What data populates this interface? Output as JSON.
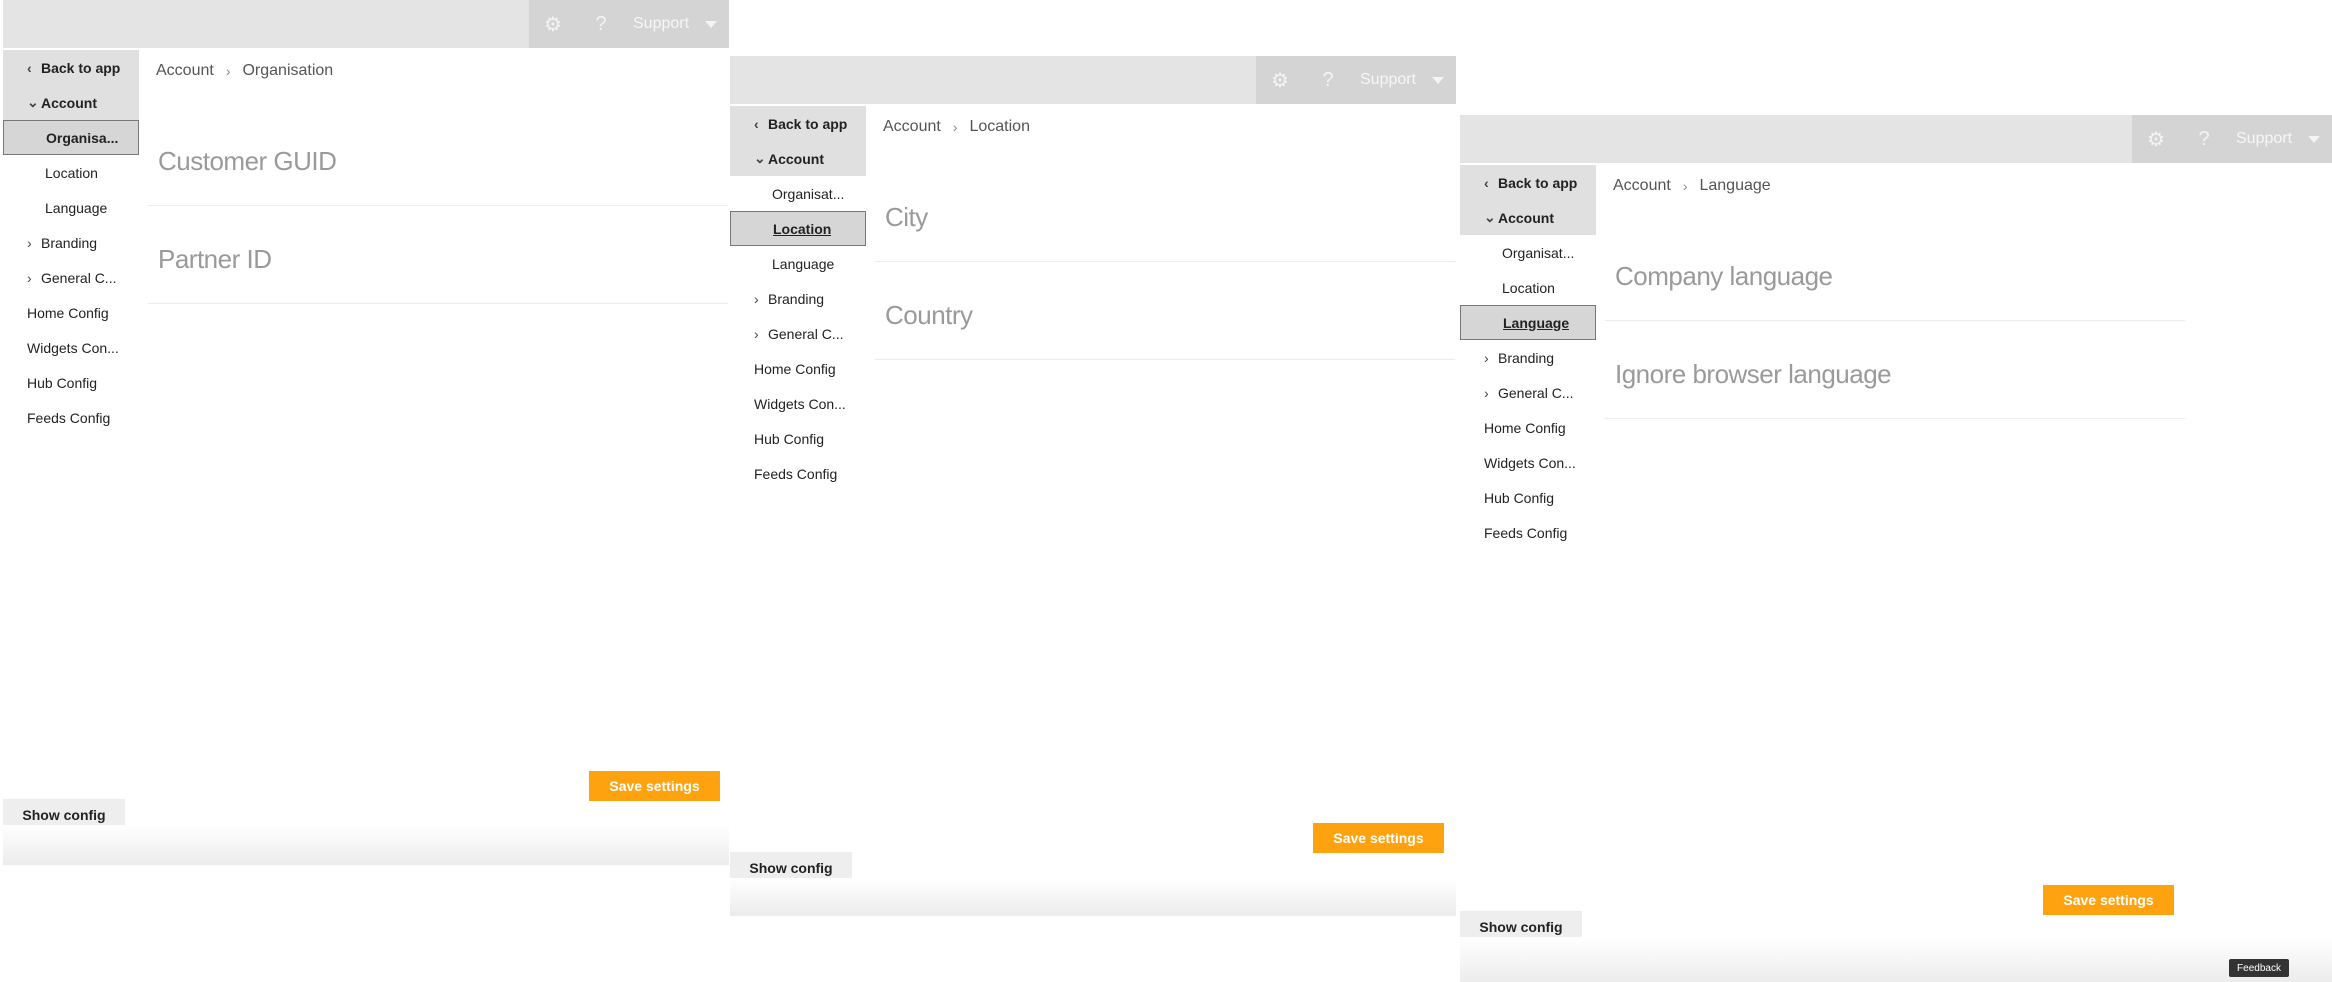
{
  "panels": [
    {
      "topbar": {
        "settings_icon": "gear-icon",
        "help_icon": "?",
        "support_label": "Support"
      },
      "sidebar": {
        "back": "Back to app",
        "account": "Account",
        "sub": [
          "Organisa...",
          "Location",
          "Language"
        ],
        "active_index": 0,
        "branding": "Branding",
        "general": "General C...",
        "home": "Home Config",
        "widgets": "Widgets Con...",
        "hub": "Hub Config",
        "feeds": "Feeds Config"
      },
      "breadcrumb": {
        "root": "Account",
        "current": "Organisation"
      },
      "fields": [
        "Customer GUID",
        "Partner ID"
      ],
      "save_label": "Save settings",
      "show_config_label": "Show config"
    },
    {
      "topbar": {
        "settings_icon": "gear-icon",
        "help_icon": "?",
        "support_label": "Support"
      },
      "sidebar": {
        "back": "Back to app",
        "account": "Account",
        "sub": [
          "Organisat...",
          "Location",
          "Language"
        ],
        "active_index": 1,
        "branding": "Branding",
        "general": "General C...",
        "home": "Home Config",
        "widgets": "Widgets Con...",
        "hub": "Hub Config",
        "feeds": "Feeds Config"
      },
      "breadcrumb": {
        "root": "Account",
        "current": "Location"
      },
      "fields": [
        "City",
        "Country"
      ],
      "save_label": "Save settings",
      "show_config_label": "Show config"
    },
    {
      "topbar": {
        "settings_icon": "gear-icon",
        "help_icon": "?",
        "support_label": "Support"
      },
      "sidebar": {
        "back": "Back to app",
        "account": "Account",
        "sub": [
          "Organisat...",
          "Location",
          "Language"
        ],
        "active_index": 2,
        "branding": "Branding",
        "general": "General C...",
        "home": "Home Config",
        "widgets": "Widgets Con...",
        "hub": "Hub Config",
        "feeds": "Feeds Config"
      },
      "breadcrumb": {
        "root": "Account",
        "current": "Language"
      },
      "fields": [
        "Company language",
        "Ignore browser language"
      ],
      "save_label": "Save settings",
      "show_config_label": "Show config"
    }
  ],
  "feedback_label": "Feedback",
  "colors": {
    "accent": "#ffa20f",
    "topbar": "#e4e4e4",
    "sidebar": "#e0e0e0"
  }
}
